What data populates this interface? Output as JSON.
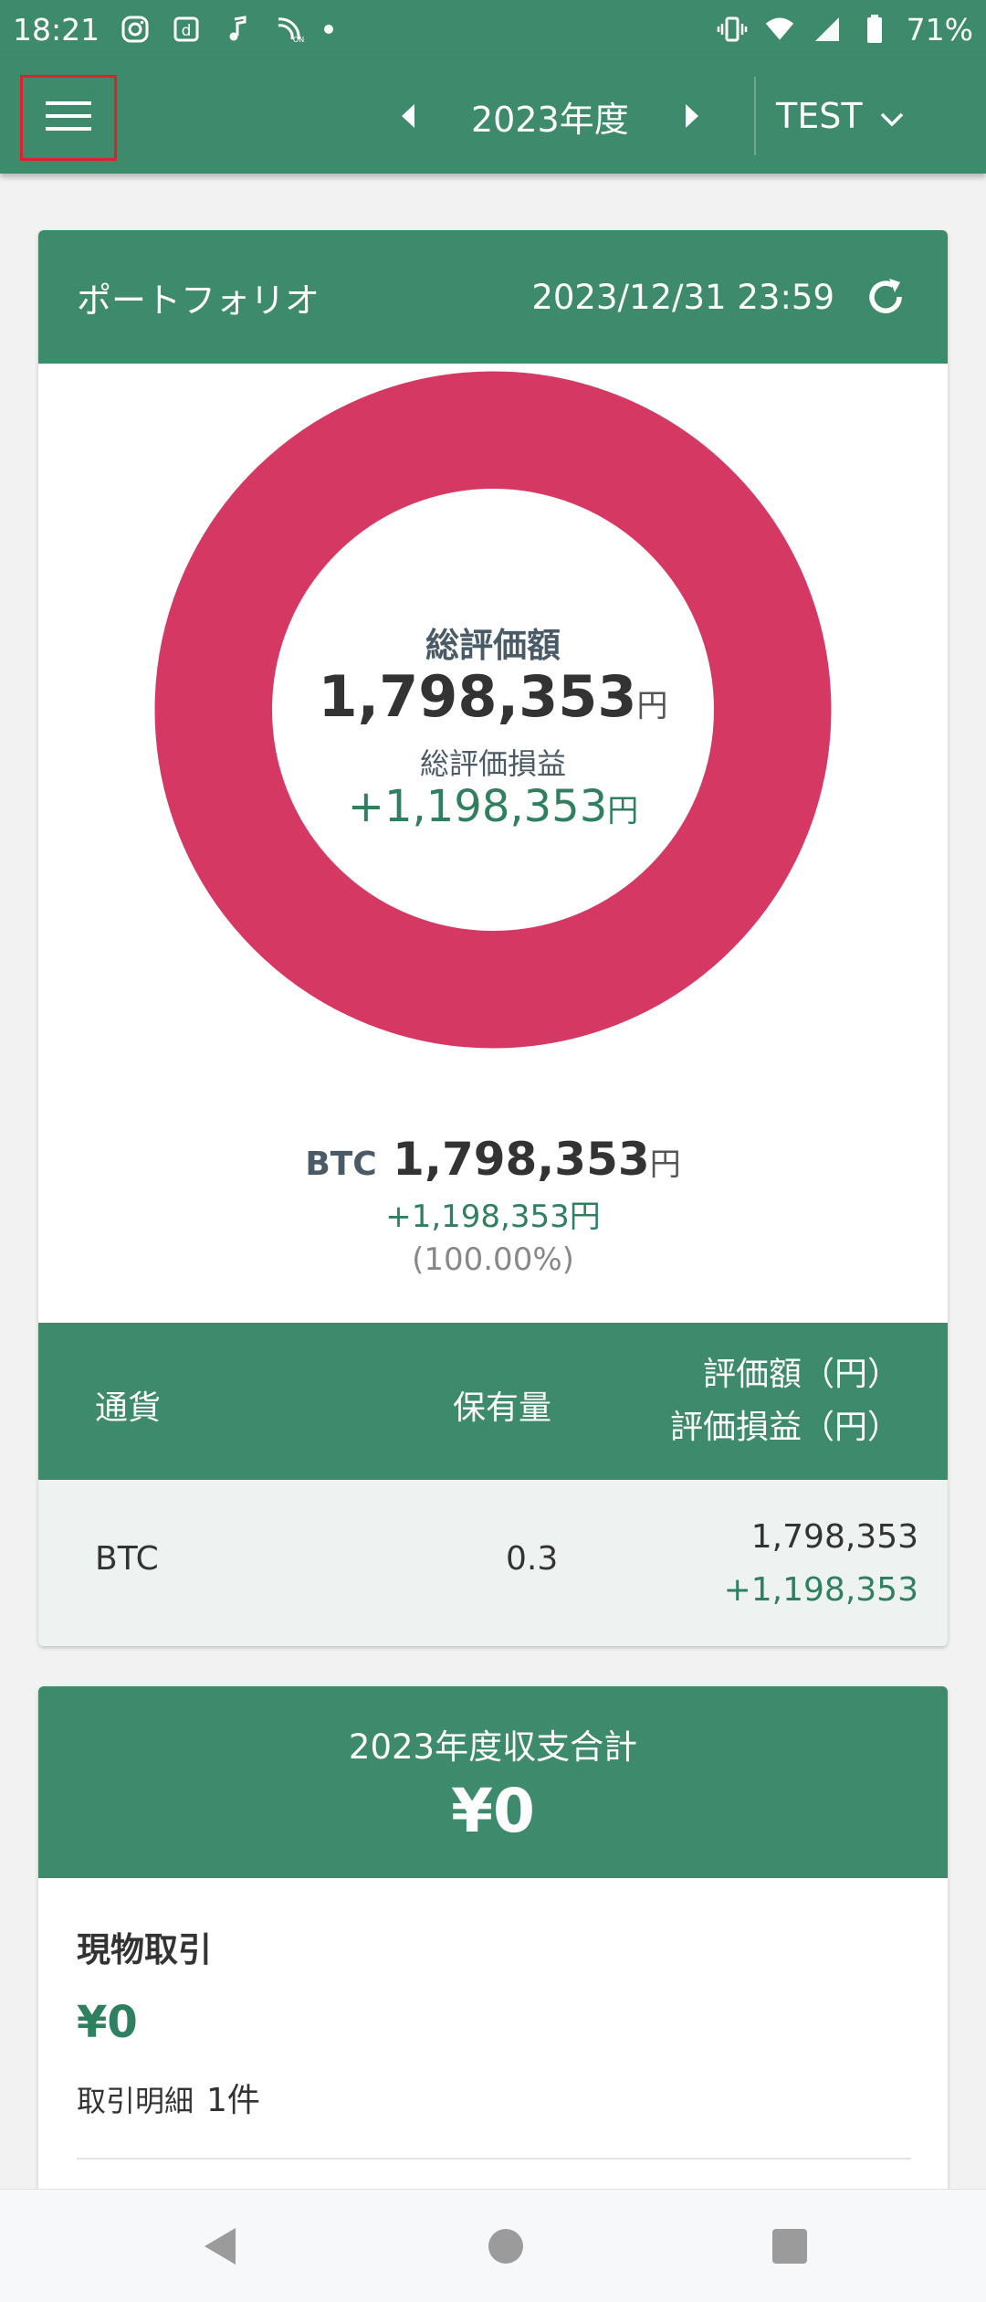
{
  "status_bar": {
    "time": "18:21",
    "battery": "71%",
    "left_icons": [
      "instagram-icon",
      "app-d-icon",
      "music-note-icon",
      "tv-on-icon",
      "dot-icon"
    ],
    "right_icons": [
      "vibrate-icon",
      "wifi-icon",
      "signal-icon",
      "battery-icon"
    ]
  },
  "app_bar": {
    "year_label": "2023年度",
    "account": "TEST"
  },
  "portfolio": {
    "title": "ポートフォリオ",
    "date": "2023/12/31 23:59",
    "total_label": "総評価額",
    "total_value": "1,798,353",
    "unit": "円",
    "gain_label": "総評価損益",
    "gain_value": "+1,198,353",
    "legend": {
      "symbol": "BTC",
      "value": "1,798,353",
      "gain": "+1,198,353",
      "percent": "(100.00%)"
    },
    "table": {
      "headers": {
        "currency": "通貨",
        "quantity": "保有量",
        "value": "評価額（円）",
        "gain": "評価損益（円）"
      },
      "rows": [
        {
          "currency": "BTC",
          "quantity": "0.3",
          "value": "1,798,353",
          "gain": "+1,198,353"
        }
      ]
    }
  },
  "chart_data": {
    "type": "pie",
    "categories": [
      "BTC"
    ],
    "values": [
      1798353
    ],
    "colors": {
      "BTC": "#d63864"
    },
    "title": "総評価額"
  },
  "summary": {
    "title": "2023年度収支合計",
    "total": "¥0",
    "spot": {
      "title": "現物取引",
      "amount": "¥0",
      "detail_label": "取引明細",
      "count": "1件"
    }
  },
  "colors": {
    "primary": "#3d8a6c",
    "gain": "#2f7f61",
    "donut": "#d63864",
    "highlight_border": "#e0202a"
  }
}
